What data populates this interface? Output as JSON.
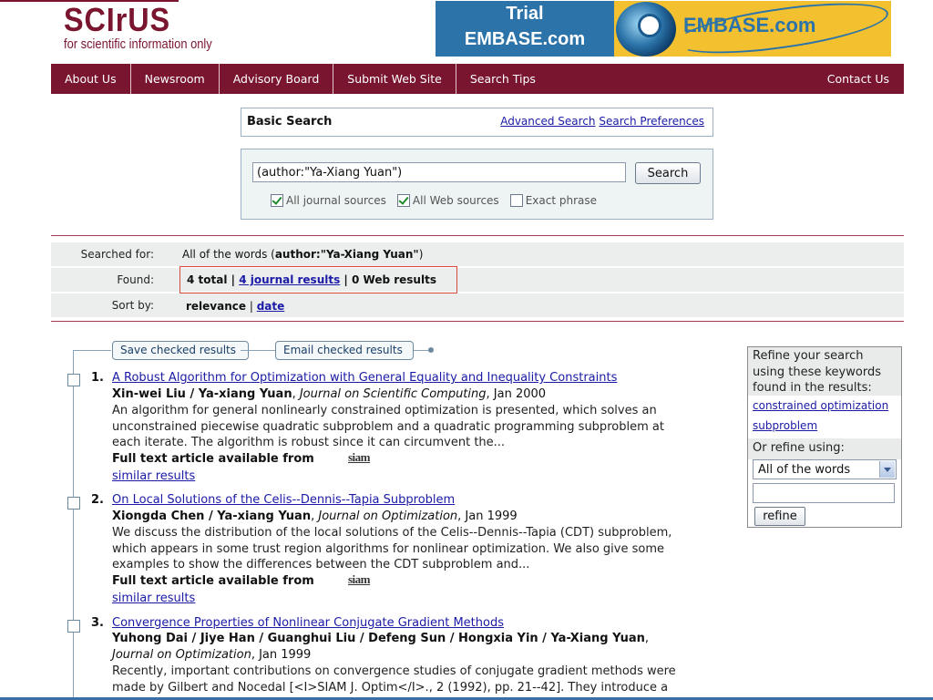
{
  "logo": {
    "main": "SCIrUS",
    "tagline": "for scientific information only"
  },
  "banner": {
    "line1": "Trial",
    "line2": "EMBASE.com",
    "brand": "EMBASE.com"
  },
  "nav": {
    "items": [
      "About Us",
      "Newsroom",
      "Advisory Board",
      "Submit Web Site",
      "Search Tips"
    ],
    "contact": "Contact Us"
  },
  "search": {
    "title": "Basic Search",
    "advanced_link": "Advanced Search",
    "preferences_link": "Search Preferences",
    "query": "(author:\"Ya-Xiang Yuan\")",
    "button": "Search",
    "options": [
      {
        "label": "All journal sources",
        "checked": true
      },
      {
        "label": "All Web sources",
        "checked": true
      },
      {
        "label": "Exact phrase",
        "checked": false
      }
    ]
  },
  "summary": {
    "searched_label": "Searched for:",
    "searched_prefix": "All of the words (",
    "searched_query": "author:\"Ya-Xiang Yuan\"",
    "searched_suffix": ")",
    "found_label": "Found:",
    "found_total": "4 total",
    "found_sep1": " | ",
    "found_journal": "4 journal results",
    "found_sep2": " | ",
    "found_web": "0 Web results",
    "sort_label": "Sort by:",
    "sort_relevance": "relevance",
    "sort_sep": " | ",
    "sort_date": "date"
  },
  "actions": {
    "save": "Save checked results",
    "email": "Email checked results"
  },
  "results": [
    {
      "num": "1.",
      "title": "A Robust Algorithm for Optimization with General Equality and Inequality Constraints",
      "authors": "Xin-wei Liu / Ya-xiang Yuan",
      "journal": "Journal on Scientific Computing",
      "date": ", Jan 2000",
      "abstract_lines": [
        "An algorithm for general nonlinearly constrained optimization is presented, which solves an",
        "unconstrained piecewise quadratic subproblem and a quadratic programming subproblem at",
        "each iterate. The algorithm is robust since it can circumvent the..."
      ],
      "fulltext": "Full text article available from",
      "source_logo": "siam",
      "similar": "similar results"
    },
    {
      "num": "2.",
      "title": "On Local Solutions of the Celis--Dennis--Tapia Subproblem",
      "authors": "Xiongda Chen / Ya-xiang Yuan",
      "journal": "Journal on Optimization",
      "date": ", Jan 1999",
      "abstract_lines": [
        "We discuss the distribution of the local solutions of the Celis--Dennis--Tapia (CDT) subproblem,",
        "which appears in some trust region algorithms for nonlinear optimization. We also give some",
        "examples to show the differences between the CDT subproblem and..."
      ],
      "fulltext": "Full text article available from",
      "source_logo": "siam",
      "similar": "similar results"
    },
    {
      "num": "3.",
      "title": "Convergence Properties of Nonlinear Conjugate Gradient Methods",
      "authors": "Yuhong Dai / Jiye Han / Guanghui Liu / Defeng Sun / Hongxia Yin / Ya-Xiang Yuan",
      "journal": "Journal on Optimization",
      "date": ", Jan 1999",
      "abstract_lines": [
        "Recently, important contributions on convergence studies of conjugate gradient methods were",
        "made by Gilbert and Nocedal [<I>SIAM J. Optim</I>., 2 (1992), pp. 21--42]. They introduce a"
      ]
    }
  ],
  "refine": {
    "intro": "Refine your search using these keywords found in the results:",
    "keywords": [
      "constrained optimization",
      "subproblem"
    ],
    "or_label": "Or refine using:",
    "select_value": "All of the words",
    "button": "refine"
  },
  "colors": {
    "brand": "#7a1530",
    "link": "#1a1aa6",
    "panel": "#eef3f3",
    "highlight_box": "#d9483b"
  }
}
